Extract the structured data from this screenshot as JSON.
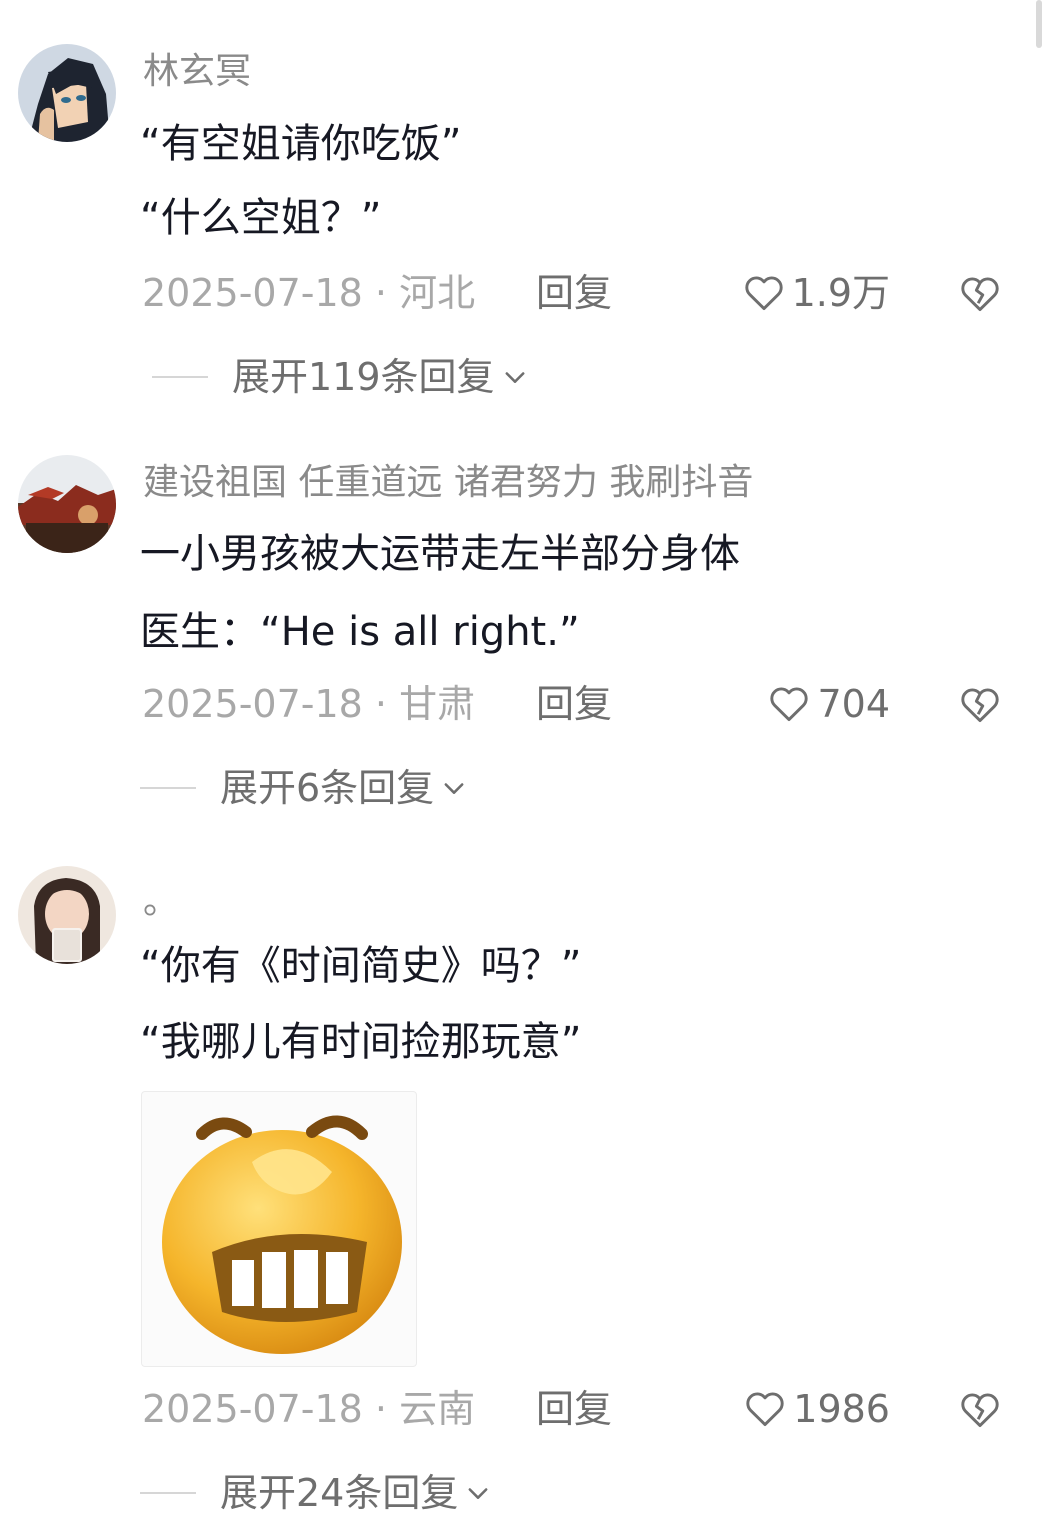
{
  "comments": [
    {
      "username": "林玄冥",
      "lines": [
        "“有空姐请你吃饭”",
        "“什么空姐？”"
      ],
      "date": "2025-07-18 · 河北",
      "reply_label": "回复",
      "likes": "1.9万",
      "expand_label": "展开119条回复"
    },
    {
      "username": "建设祖国 任重道远 诸君努力 我刷抖音",
      "lines": [
        "一小男孩被大运带走左半部分身体",
        "医生：“He is all right.”"
      ],
      "date": "2025-07-18 · 甘肃",
      "reply_label": "回复",
      "likes": "704",
      "expand_label": "展开6条回复"
    },
    {
      "username": "。",
      "lines": [
        "“你有《时间简史》吗？”",
        "“我哪儿有时间捡那玩意”"
      ],
      "date": "2025-07-18 · 云南",
      "reply_label": "回复",
      "likes": "1986",
      "expand_label": "展开24条回复"
    }
  ],
  "colors": {
    "text": "#161823",
    "secondary": "#8a8a8a",
    "action": "#6e6e6e",
    "sticker": "#f2b52a"
  }
}
